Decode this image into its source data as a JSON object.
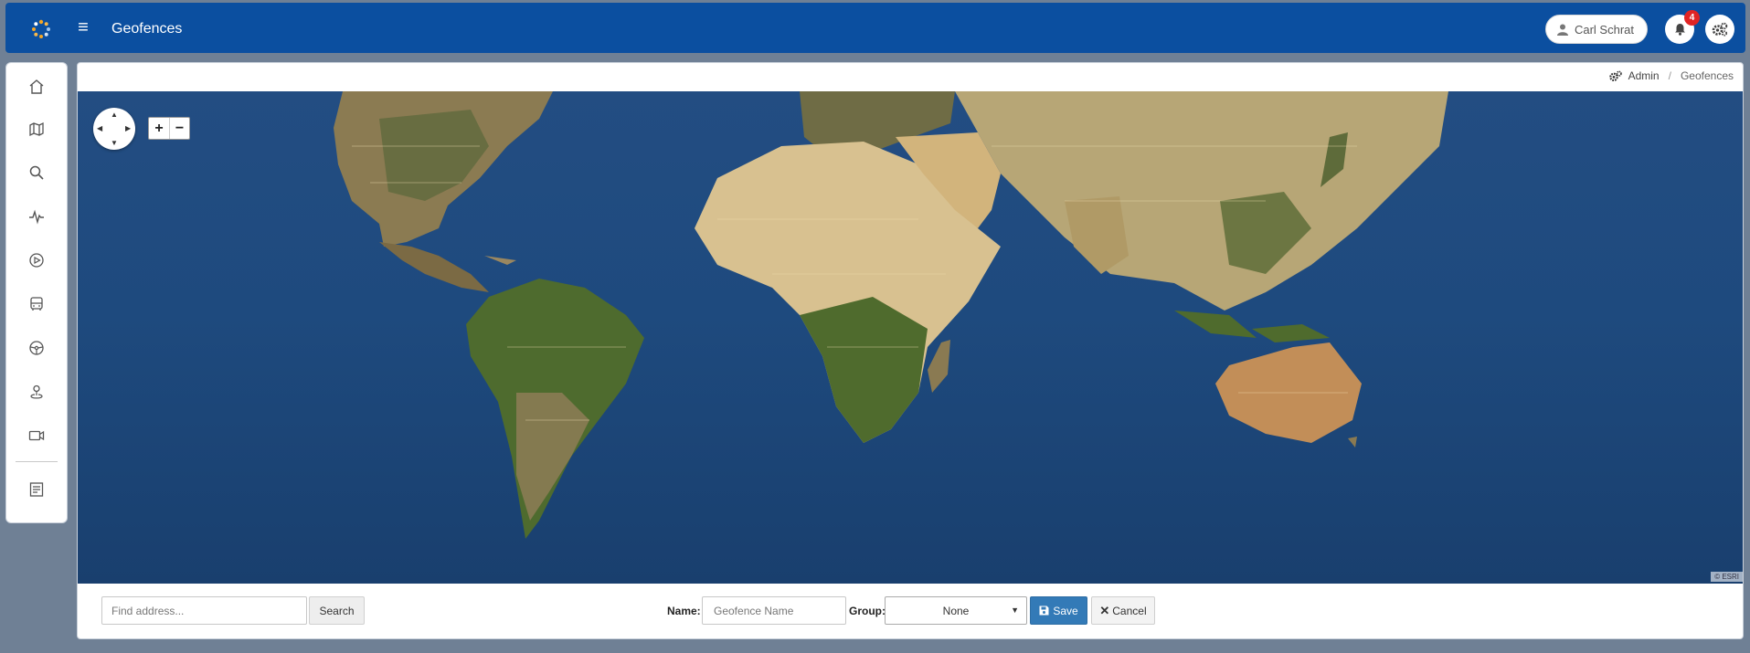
{
  "header": {
    "title": "Geofences",
    "user_name": "Carl Schrat",
    "notification_count": "4",
    "colors": {
      "bar": "#0b4fa0",
      "badge": "#e02424"
    }
  },
  "sidebar": {
    "items": [
      {
        "icon": "home-icon"
      },
      {
        "icon": "map-icon"
      },
      {
        "icon": "search-icon"
      },
      {
        "icon": "pulse-icon"
      },
      {
        "icon": "play-icon"
      },
      {
        "icon": "bus-icon"
      },
      {
        "icon": "steering-wheel-icon"
      },
      {
        "icon": "location-pin-icon"
      },
      {
        "icon": "video-camera-icon"
      },
      {
        "icon": "report-icon"
      }
    ]
  },
  "breadcrumb": {
    "admin": "Admin",
    "current": "Geofences"
  },
  "map": {
    "attribution": "© ESRI",
    "zoom_in": "+",
    "zoom_out": "−"
  },
  "form": {
    "find_placeholder": "Find address...",
    "search_label": "Search",
    "name_label": "Name:",
    "name_placeholder": "Geofence Name",
    "group_label": "Group:",
    "group_value": "None",
    "save_label": "Save",
    "cancel_label": "Cancel"
  }
}
